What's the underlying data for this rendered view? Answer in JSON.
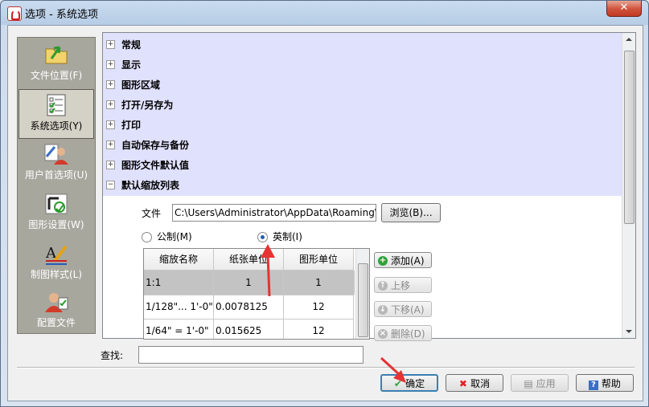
{
  "window": {
    "title": "选项 - 系统选项",
    "close_label": "✕"
  },
  "sidebar": {
    "items": [
      {
        "label": "文件位置(F)",
        "icon": "folder-arrow-icon",
        "selected": false
      },
      {
        "label": "系统选项(Y)",
        "icon": "checklist-icon",
        "selected": true
      },
      {
        "label": "用户首选项(U)",
        "icon": "user-pencil-icon",
        "selected": false
      },
      {
        "label": "图形设置(W)",
        "icon": "graphics-settings-icon",
        "selected": false
      },
      {
        "label": "制图样式(L)",
        "icon": "drafting-style-icon",
        "selected": false
      },
      {
        "label": "配置文件",
        "icon": "user-profile-icon",
        "selected": false
      }
    ]
  },
  "tree": {
    "nodes": [
      {
        "label": "常规",
        "expanded": false
      },
      {
        "label": "显示",
        "expanded": false
      },
      {
        "label": "图形区域",
        "expanded": false
      },
      {
        "label": "打开/另存为",
        "expanded": false
      },
      {
        "label": "打印",
        "expanded": false
      },
      {
        "label": "自动保存与备份",
        "expanded": false
      },
      {
        "label": "图形文件默认值",
        "expanded": false
      },
      {
        "label": "默认缩放列表",
        "expanded": true
      }
    ],
    "expand_glyph": "+",
    "collapse_glyph": "−"
  },
  "scale_list": {
    "file_label": "文件",
    "file_value": "C:\\Users\\Administrator\\AppData\\Roaming\\",
    "browse_label": "浏览(B)...",
    "metric_label": "公制(M)",
    "imperial_label": "英制(I)",
    "selected_unit": "imperial",
    "columns": [
      "缩放名称",
      "纸张单位",
      "图形单位"
    ],
    "rows": [
      {
        "name": "1:1",
        "paper": "1",
        "drawing": "1",
        "selected": true
      },
      {
        "name": "1/128\"... 1'-0\"",
        "paper": "0.0078125",
        "drawing": "12",
        "selected": false
      },
      {
        "name": "1/64\" = 1'-0\"",
        "paper": "0.015625",
        "drawing": "12",
        "selected": false
      }
    ],
    "buttons": {
      "add": "添加(A)",
      "up": "上移",
      "down": "下移(A)",
      "delete": "删除(D)"
    }
  },
  "find": {
    "label": "查找:",
    "value": ""
  },
  "footer": {
    "ok": "确定",
    "cancel": "取消",
    "apply": "应用",
    "help": "帮助"
  },
  "colors": {
    "tree_highlight": "#e0e1fd",
    "sidebar_bg": "#a8a79e",
    "annotation_arrow": "#e53333",
    "close_button": "#c8432b"
  }
}
